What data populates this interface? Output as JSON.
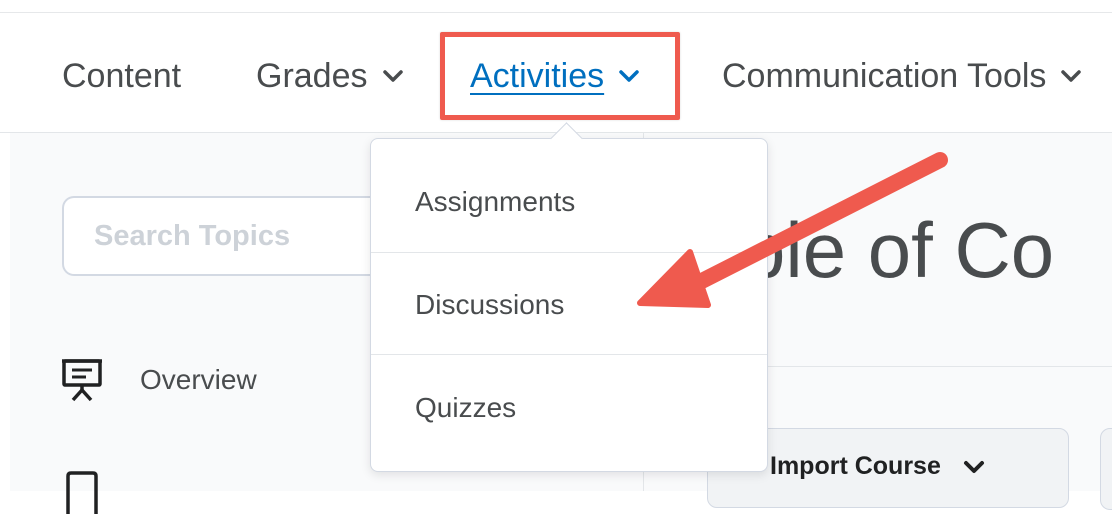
{
  "nav": {
    "items": [
      {
        "label": "Content",
        "has_chevron": false
      },
      {
        "label": "Grades",
        "has_chevron": true
      },
      {
        "label": "Activities",
        "has_chevron": true,
        "active": true
      },
      {
        "label": "Communication Tools",
        "has_chevron": true
      }
    ]
  },
  "dropdown": {
    "items": [
      "Assignments",
      "Discussions",
      "Quizzes"
    ]
  },
  "sidebar": {
    "search_placeholder": "Search Topics",
    "items": [
      {
        "label": "Overview",
        "icon": "presentation-icon"
      },
      {
        "label": "",
        "icon": "bookmark-icon"
      }
    ]
  },
  "main": {
    "title_fragment": "ble of Co",
    "import_label": "Import Course"
  },
  "colors": {
    "accent_link": "#006fbf",
    "annotation_red": "#ef5a4e",
    "text": "#494c4e"
  }
}
